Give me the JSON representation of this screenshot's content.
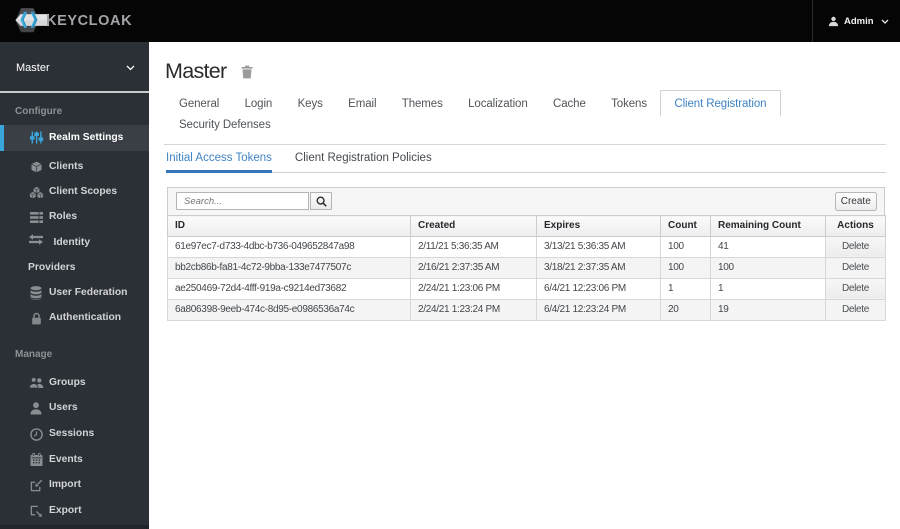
{
  "navbar": {
    "brand": "KEYCLOAK",
    "user": "Admin"
  },
  "sidebar": {
    "realm": "Master",
    "configure_label": "Configure",
    "manage_label": "Manage",
    "configure_items": [
      {
        "label": "Realm Settings"
      },
      {
        "label": "Clients"
      },
      {
        "label": "Client Scopes"
      },
      {
        "label": "Roles"
      },
      {
        "label": "Identity Providers"
      },
      {
        "label": "User Federation"
      },
      {
        "label": "Authentication"
      }
    ],
    "manage_items": [
      {
        "label": "Groups"
      },
      {
        "label": "Users"
      },
      {
        "label": "Sessions"
      },
      {
        "label": "Events"
      },
      {
        "label": "Import"
      },
      {
        "label": "Export"
      }
    ]
  },
  "page": {
    "title": "Master"
  },
  "tabs": {
    "items": [
      "General",
      "Login",
      "Keys",
      "Email",
      "Themes",
      "Localization",
      "Cache",
      "Tokens",
      "Client Registration",
      "Security Defenses"
    ],
    "active": "Client Registration"
  },
  "subtabs": {
    "items": [
      "Initial Access Tokens",
      "Client Registration Policies"
    ],
    "active": "Initial Access Tokens"
  },
  "toolbar": {
    "search_placeholder": "Search...",
    "create_label": "Create"
  },
  "table": {
    "headers": [
      "ID",
      "Created",
      "Expires",
      "Count",
      "Remaining Count",
      "Actions"
    ],
    "rows": [
      {
        "id": "61e97ec7-d733-4dbc-b736-049652847a98",
        "created": "2/11/21 5:36:35 AM",
        "expires": "3/13/21 5:36:35 AM",
        "count": "100",
        "remaining": "41",
        "action": "Delete"
      },
      {
        "id": "bb2cb86b-fa81-4c72-9bba-133e7477507c",
        "created": "2/16/21 2:37:35 AM",
        "expires": "3/18/21 2:37:35 AM",
        "count": "100",
        "remaining": "100",
        "action": "Delete"
      },
      {
        "id": "ae250469-72d4-4fff-919a-c9214ed73682",
        "created": "2/24/21 1:23:06 PM",
        "expires": "6/4/21 12:23:06 PM",
        "count": "1",
        "remaining": "1",
        "action": "Delete"
      },
      {
        "id": "6a806398-9eeb-474c-8d95-e0986536a74c",
        "created": "2/24/21 1:23:24 PM",
        "expires": "6/4/21 12:23:24 PM",
        "count": "20",
        "remaining": "19",
        "action": "Delete"
      }
    ]
  },
  "colors": {
    "accent_blue": "#3aa6dc",
    "tab_blue": "#3f83c4",
    "sidebar_bg": "#2b3036",
    "navbar_bg": "#050505"
  }
}
